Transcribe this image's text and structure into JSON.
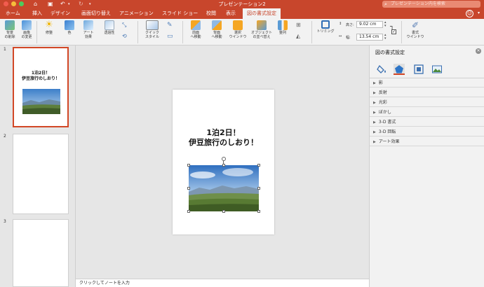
{
  "window": {
    "title": "プレゼンテーション2",
    "search_placeholder": "プレゼンテーション内を検索"
  },
  "tabs": [
    "ホーム",
    "挿入",
    "デザイン",
    "画面切り替え",
    "アニメーション",
    "スライド ショー",
    "校閲",
    "表示",
    "図の書式設定"
  ],
  "active_tab": "図の書式設定",
  "ribbon": {
    "remove_background": "背景\nの削除",
    "change_picture": "画像\nの変更",
    "corrections": "修整",
    "color": "色",
    "artistic_effects": "アート\n効果",
    "transparency": "透過性",
    "quick_styles": "クイック\nスタイル",
    "bring_forward": "前面\nへ移動",
    "send_backward": "背面\nへ移動",
    "selection_pane": "選択\nウインドウ",
    "arrange_objects": "オブジェクト\nの並べ替え",
    "align": "整列",
    "crop": "トリミング",
    "height_label": "高さ:",
    "height_value": "9.02 cm",
    "width_label": "幅:",
    "width_value": "13.54 cm",
    "format_pane": "書式\nウインドウ"
  },
  "thumbnails": [
    {
      "number": "1",
      "title": "1泊2日！\n伊豆旅行のしおり！"
    },
    {
      "number": "2",
      "title": ""
    },
    {
      "number": "3",
      "title": ""
    }
  ],
  "slide": {
    "title": "1泊2日！\n伊豆旅行のしおり！"
  },
  "notes_placeholder": "クリックしてノートを入力",
  "format_pane": {
    "title": "図の書式設定",
    "close_icon": "close-icon",
    "sections": [
      "影",
      "反射",
      "光彩",
      "ぼかし",
      "3-D 書式",
      "3-D 回転",
      "アート効果"
    ]
  }
}
